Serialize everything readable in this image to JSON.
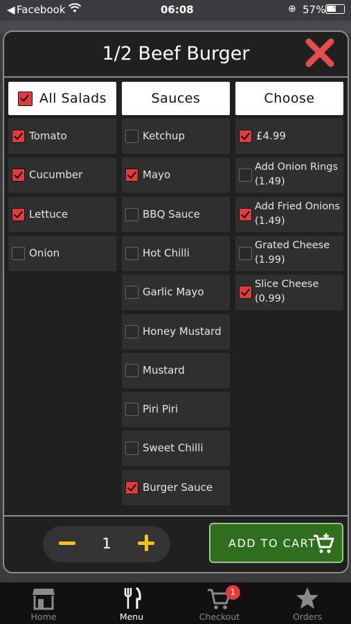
{
  "status": {
    "back": "◀",
    "carrier": "Facebook",
    "time": "06:08",
    "battery": "57%",
    "battery_level": 0.57
  },
  "modal": {
    "title": "1/2 Beef Burger",
    "columns": [
      {
        "heading": "All Salads",
        "heading_checked": true,
        "items": [
          {
            "label": "Tomato",
            "checked": true
          },
          {
            "label": "Cucumber",
            "checked": true
          },
          {
            "label": "Lettuce",
            "checked": true
          },
          {
            "label": "Onion",
            "checked": false
          }
        ]
      },
      {
        "heading": "Sauces",
        "items": [
          {
            "label": "Ketchup",
            "checked": false
          },
          {
            "label": "Mayo",
            "checked": true
          },
          {
            "label": "BBQ Sauce",
            "checked": false
          },
          {
            "label": "Hot Chilli",
            "checked": false
          },
          {
            "label": "Garlic Mayo",
            "checked": false
          },
          {
            "label": "Honey Mustard",
            "checked": false
          },
          {
            "label": "Mustard",
            "checked": false
          },
          {
            "label": "Piri Piri",
            "checked": false
          },
          {
            "label": "Sweet Chilli",
            "checked": false
          },
          {
            "label": "Burger Sauce",
            "checked": true
          }
        ]
      },
      {
        "heading": "Choose",
        "items": [
          {
            "label": "£4.99",
            "checked": true
          },
          {
            "label": "Add Onion Rings",
            "sub": "(1.49)",
            "checked": false
          },
          {
            "label": "Add Fried Onions",
            "sub": "(1.49)",
            "checked": true
          },
          {
            "label": "Grated Cheese",
            "sub": "(1.99)",
            "checked": false
          },
          {
            "label": "Slice Cheese",
            "sub": "(0.99)",
            "checked": true
          }
        ]
      }
    ],
    "quantity": "1",
    "add_to_cart": "ADD TO CART"
  },
  "colors": {
    "accent": "#e23b3b",
    "cart_green": "#2f6e1c",
    "qty_yellow": "#f5c21b"
  },
  "tabbar": {
    "tabs": [
      {
        "label": "Home",
        "icon": "store-icon"
      },
      {
        "label": "Menu",
        "icon": "cutlery-icon",
        "active": true
      },
      {
        "label": "Checkout",
        "icon": "cart-icon",
        "badge": "1"
      },
      {
        "label": "Orders",
        "icon": "star-icon"
      }
    ]
  }
}
